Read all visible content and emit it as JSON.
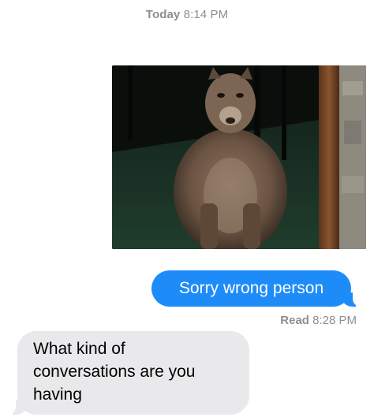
{
  "thread": {
    "timestamp_day": "Today",
    "timestamp_time": "8:14 PM",
    "image": {
      "description_icon": "cougar-photo",
      "colors": {
        "background": "#0d130f",
        "floor": "#1e3a2c",
        "post": "#7a4a2a",
        "animal": "#7a6452"
      }
    },
    "outgoing_message": {
      "text": "Sorry wrong person",
      "bubble_color": "#1d8cf8"
    },
    "read_receipt": {
      "label": "Read",
      "time": "8:28 PM"
    },
    "incoming_message": {
      "lines": [
        "What kind of",
        "conversations are you",
        "having"
      ],
      "bubble_color": "#e9e9eb"
    }
  }
}
